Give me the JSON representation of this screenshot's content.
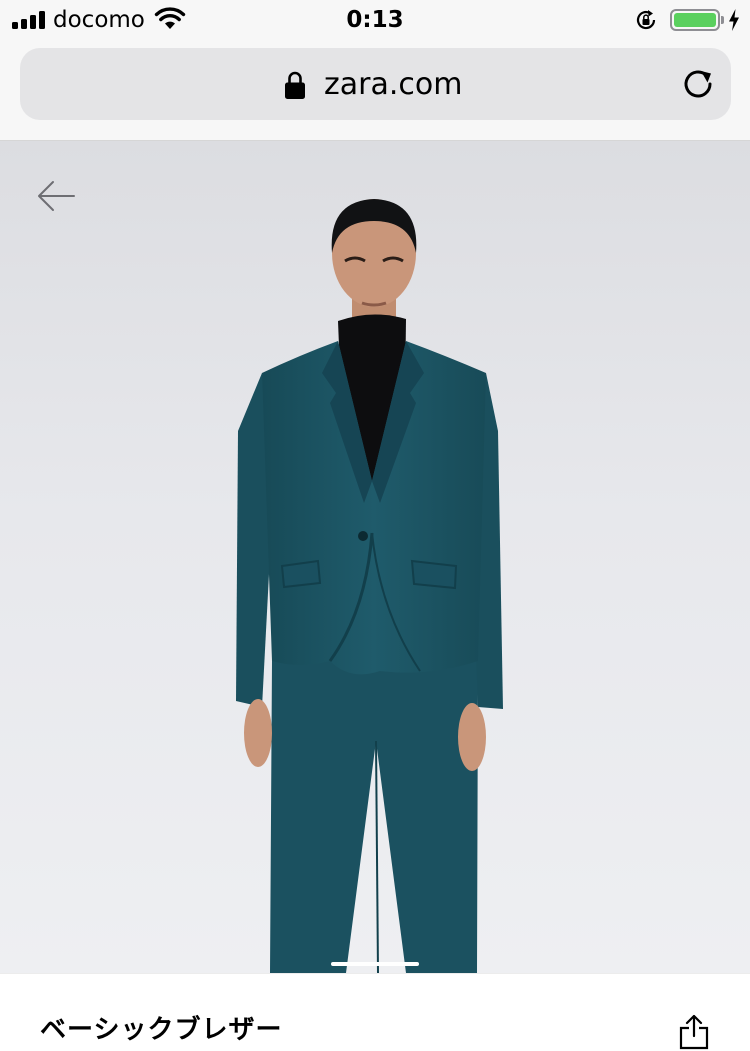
{
  "status_bar": {
    "carrier": "docomo",
    "time": "0:13",
    "battery_color": "#5ad05e"
  },
  "browser": {
    "url": "zara.com",
    "icons": [
      "lock-icon",
      "reload-icon"
    ]
  },
  "product": {
    "title": "ベーシックブレザー",
    "jacket_color": "#1d5665",
    "icons": [
      "back-arrow-icon",
      "share-icon"
    ],
    "image_count_indicator": "carousel-indicator"
  }
}
